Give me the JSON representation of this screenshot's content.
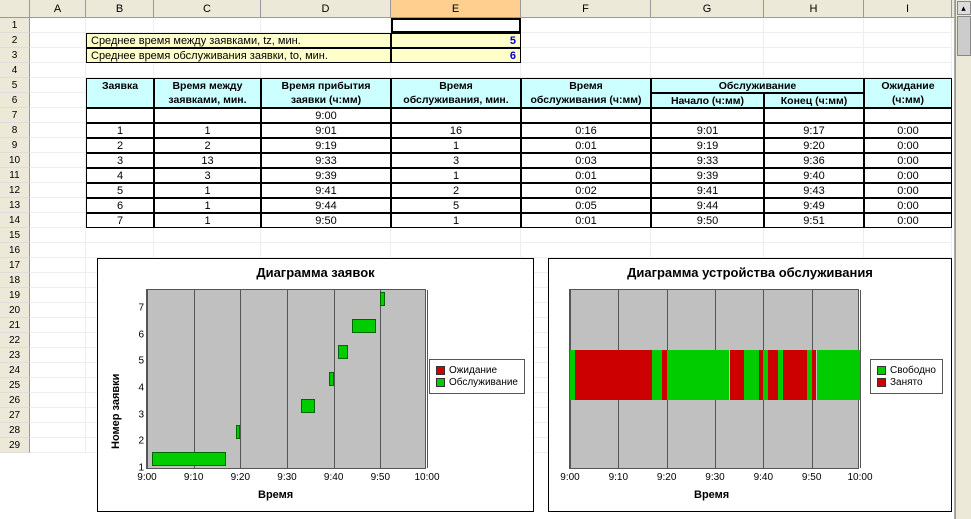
{
  "columns": [
    "A",
    "B",
    "C",
    "D",
    "E",
    "F",
    "G",
    "H",
    "I"
  ],
  "active_column": "E",
  "params": {
    "label_tz": "Среднее время между заявками, tz, мин.",
    "value_tz": "5",
    "label_to": "Среднее время обслуживания заявки, to, мин.",
    "value_to": "6"
  },
  "headers": {
    "zayavka": "Заявка",
    "mezhdu": "Время между заявками, мин.",
    "pribyt": "Время прибытия заявки (ч:мм)",
    "obsl_min": "Время обслуживания, мин.",
    "obsl_hm": "Время обслуживания (ч:мм)",
    "obsl": "Обслуживание",
    "nachalo": "Начало (ч:мм)",
    "konets": "Конец (ч:мм)",
    "ozhid": "Ожидание (ч:мм)"
  },
  "first_row_arrival": "9:00",
  "table": [
    {
      "n": "1",
      "between": "1",
      "arrive": "9:01",
      "svc_min": "16",
      "svc_hm": "0:16",
      "start": "9:01",
      "end": "9:17",
      "wait": "0:00"
    },
    {
      "n": "2",
      "between": "2",
      "arrive": "9:19",
      "svc_min": "1",
      "svc_hm": "0:01",
      "start": "9:19",
      "end": "9:20",
      "wait": "0:00"
    },
    {
      "n": "3",
      "between": "13",
      "arrive": "9:33",
      "svc_min": "3",
      "svc_hm": "0:03",
      "start": "9:33",
      "end": "9:36",
      "wait": "0:00"
    },
    {
      "n": "4",
      "between": "3",
      "arrive": "9:39",
      "svc_min": "1",
      "svc_hm": "0:01",
      "start": "9:39",
      "end": "9:40",
      "wait": "0:00"
    },
    {
      "n": "5",
      "between": "1",
      "arrive": "9:41",
      "svc_min": "2",
      "svc_hm": "0:02",
      "start": "9:41",
      "end": "9:43",
      "wait": "0:00"
    },
    {
      "n": "6",
      "between": "1",
      "arrive": "9:44",
      "svc_min": "5",
      "svc_hm": "0:05",
      "start": "9:44",
      "end": "9:49",
      "wait": "0:00"
    },
    {
      "n": "7",
      "between": "1",
      "arrive": "9:50",
      "svc_min": "1",
      "svc_hm": "0:01",
      "start": "9:50",
      "end": "9:51",
      "wait": "0:00"
    }
  ],
  "chart1": {
    "title": "Диаграмма заявок",
    "xlabel": "Время",
    "ylabel": "Номер заявки",
    "xticks": [
      "9:00",
      "9:10",
      "9:20",
      "9:30",
      "9:40",
      "9:50",
      "10:00"
    ],
    "yticks": [
      "1",
      "2",
      "3",
      "4",
      "5",
      "6",
      "7"
    ],
    "legend": [
      {
        "label": "Ожидание",
        "color": "#cc0000"
      },
      {
        "label": "Обслуживание",
        "color": "#00cc00"
      }
    ]
  },
  "chart2": {
    "title": "Диаграмма устройства обслуживания",
    "xlabel": "Время",
    "xticks": [
      "9:00",
      "9:10",
      "9:20",
      "9:30",
      "9:40",
      "9:50",
      "10:00"
    ],
    "legend": [
      {
        "label": "Свободно",
        "color": "#00cc00"
      },
      {
        "label": "Занято",
        "color": "#cc0000"
      }
    ]
  },
  "chart_data": [
    {
      "type": "bar",
      "orientation": "horizontal-gantt",
      "title": "Диаграмма заявок",
      "xlabel": "Время",
      "ylabel": "Номер заявки",
      "xlim": [
        "9:00",
        "10:00"
      ],
      "ylim": [
        1,
        7
      ],
      "series": [
        {
          "name": "Ожидание",
          "color": "#cc0000",
          "segments": []
        },
        {
          "name": "Обслуживание",
          "color": "#00cc00",
          "segments": [
            {
              "y": 1,
              "start": "9:01",
              "end": "9:17"
            },
            {
              "y": 2,
              "start": "9:19",
              "end": "9:20"
            },
            {
              "y": 3,
              "start": "9:33",
              "end": "9:36"
            },
            {
              "y": 4,
              "start": "9:39",
              "end": "9:40"
            },
            {
              "y": 5,
              "start": "9:41",
              "end": "9:43"
            },
            {
              "y": 6,
              "start": "9:44",
              "end": "9:49"
            },
            {
              "y": 7,
              "start": "9:50",
              "end": "9:51"
            }
          ]
        }
      ]
    },
    {
      "type": "bar",
      "orientation": "horizontal-timeline",
      "title": "Диаграмма устройства обслуживания",
      "xlabel": "Время",
      "xlim": [
        "9:00",
        "10:00"
      ],
      "series": [
        {
          "name": "Занято",
          "color": "#cc0000",
          "segments": [
            {
              "start": "9:01",
              "end": "9:17"
            },
            {
              "start": "9:19",
              "end": "9:20"
            },
            {
              "start": "9:33",
              "end": "9:36"
            },
            {
              "start": "9:39",
              "end": "9:40"
            },
            {
              "start": "9:41",
              "end": "9:43"
            },
            {
              "start": "9:44",
              "end": "9:49"
            },
            {
              "start": "9:50",
              "end": "9:51"
            }
          ]
        },
        {
          "name": "Свободно",
          "color": "#00cc00",
          "segments": [
            {
              "start": "9:00",
              "end": "9:01"
            },
            {
              "start": "9:17",
              "end": "9:19"
            },
            {
              "start": "9:20",
              "end": "9:33"
            },
            {
              "start": "9:36",
              "end": "9:39"
            },
            {
              "start": "9:40",
              "end": "9:41"
            },
            {
              "start": "9:43",
              "end": "9:44"
            },
            {
              "start": "9:49",
              "end": "9:50"
            },
            {
              "start": "9:51",
              "end": "10:00"
            }
          ]
        }
      ]
    }
  ]
}
